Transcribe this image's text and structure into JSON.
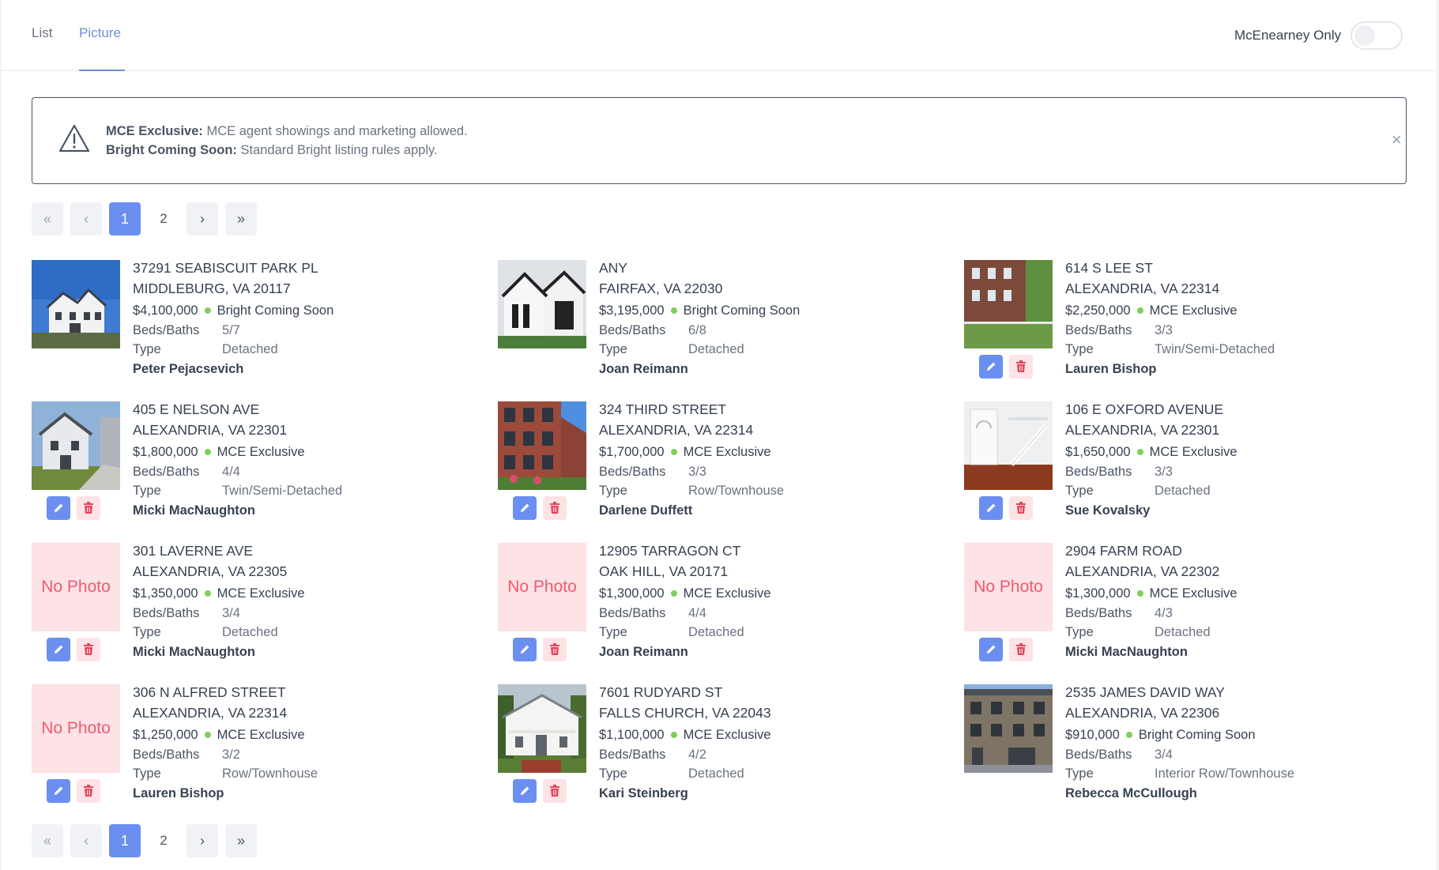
{
  "tabs": {
    "list": "List",
    "picture": "Picture"
  },
  "toggle": {
    "label": "McEnearney Only",
    "on": false
  },
  "notice": {
    "line1_bold": "MCE Exclusive:",
    "line1_text": " MCE agent showings and marketing allowed.",
    "line2_bold": "Bright Coming Soon:",
    "line2_text": " Standard Bright listing rules apply.",
    "close": "×"
  },
  "pagination": {
    "first": "«",
    "prev": "‹",
    "page1": "1",
    "page2": "2",
    "next": "›",
    "last": "»"
  },
  "field_labels": {
    "beds_baths": "Beds/Baths",
    "type": "Type"
  },
  "no_photo_text": "No Photo",
  "listings": [
    {
      "address": "37291 SEABISCUIT PARK PL",
      "city": "MIDDLEBURG, VA 20117",
      "price": "$4,100,000",
      "status": "Bright Coming Soon",
      "beds_baths": "5/7",
      "type": "Detached",
      "agent": "Peter Pejacsevich"
    },
    {
      "address": "ANY",
      "city": "FAIRFAX, VA 22030",
      "price": "$3,195,000",
      "status": "Bright Coming Soon",
      "beds_baths": "6/8",
      "type": "Detached",
      "agent": "Joan Reimann"
    },
    {
      "address": "614 S LEE ST",
      "city": "ALEXANDRIA, VA 22314",
      "price": "$2,250,000",
      "status": "MCE Exclusive",
      "beds_baths": "3/3",
      "type": "Twin/Semi-Detached",
      "agent": "Lauren Bishop"
    },
    {
      "address": "405 E NELSON AVE",
      "city": "ALEXANDRIA, VA 22301",
      "price": "$1,800,000",
      "status": "MCE Exclusive",
      "beds_baths": "4/4",
      "type": "Twin/Semi-Detached",
      "agent": "Micki MacNaughton"
    },
    {
      "address": "324 THIRD STREET",
      "city": "ALEXANDRIA, VA 22314",
      "price": "$1,700,000",
      "status": "MCE Exclusive",
      "beds_baths": "3/3",
      "type": "Row/Townhouse",
      "agent": "Darlene Duffett"
    },
    {
      "address": "106 E OXFORD AVENUE",
      "city": "ALEXANDRIA, VA 22301",
      "price": "$1,650,000",
      "status": "MCE Exclusive",
      "beds_baths": "3/3",
      "type": "Detached",
      "agent": "Sue Kovalsky"
    },
    {
      "address": "301 LAVERNE AVE",
      "city": "ALEXANDRIA, VA 22305",
      "price": "$1,350,000",
      "status": "MCE Exclusive",
      "beds_baths": "3/4",
      "type": "Detached",
      "agent": "Micki MacNaughton"
    },
    {
      "address": "12905 TARRAGON CT",
      "city": "OAK HILL, VA 20171",
      "price": "$1,300,000",
      "status": "MCE Exclusive",
      "beds_baths": "4/4",
      "type": "Detached",
      "agent": "Joan Reimann"
    },
    {
      "address": "2904 FARM ROAD",
      "city": "ALEXANDRIA, VA 22302",
      "price": "$1,300,000",
      "status": "MCE Exclusive",
      "beds_baths": "4/3",
      "type": "Detached",
      "agent": "Micki MacNaughton"
    },
    {
      "address": "306 N ALFRED STREET",
      "city": "ALEXANDRIA, VA 22314",
      "price": "$1,250,000",
      "status": "MCE Exclusive",
      "beds_baths": "3/2",
      "type": "Row/Townhouse",
      "agent": "Lauren Bishop"
    },
    {
      "address": "7601 RUDYARD ST",
      "city": "FALLS CHURCH, VA 22043",
      "price": "$1,100,000",
      "status": "MCE Exclusive",
      "beds_baths": "4/2",
      "type": "Detached",
      "agent": "Kari Steinberg"
    },
    {
      "address": "2535 JAMES DAVID WAY",
      "city": "ALEXANDRIA, VA 22306",
      "price": "$910,000",
      "status": "Bright Coming Soon",
      "beds_baths": "3/4",
      "type": "Interior Row/Townhouse",
      "agent": "Rebecca McCullough"
    }
  ]
}
